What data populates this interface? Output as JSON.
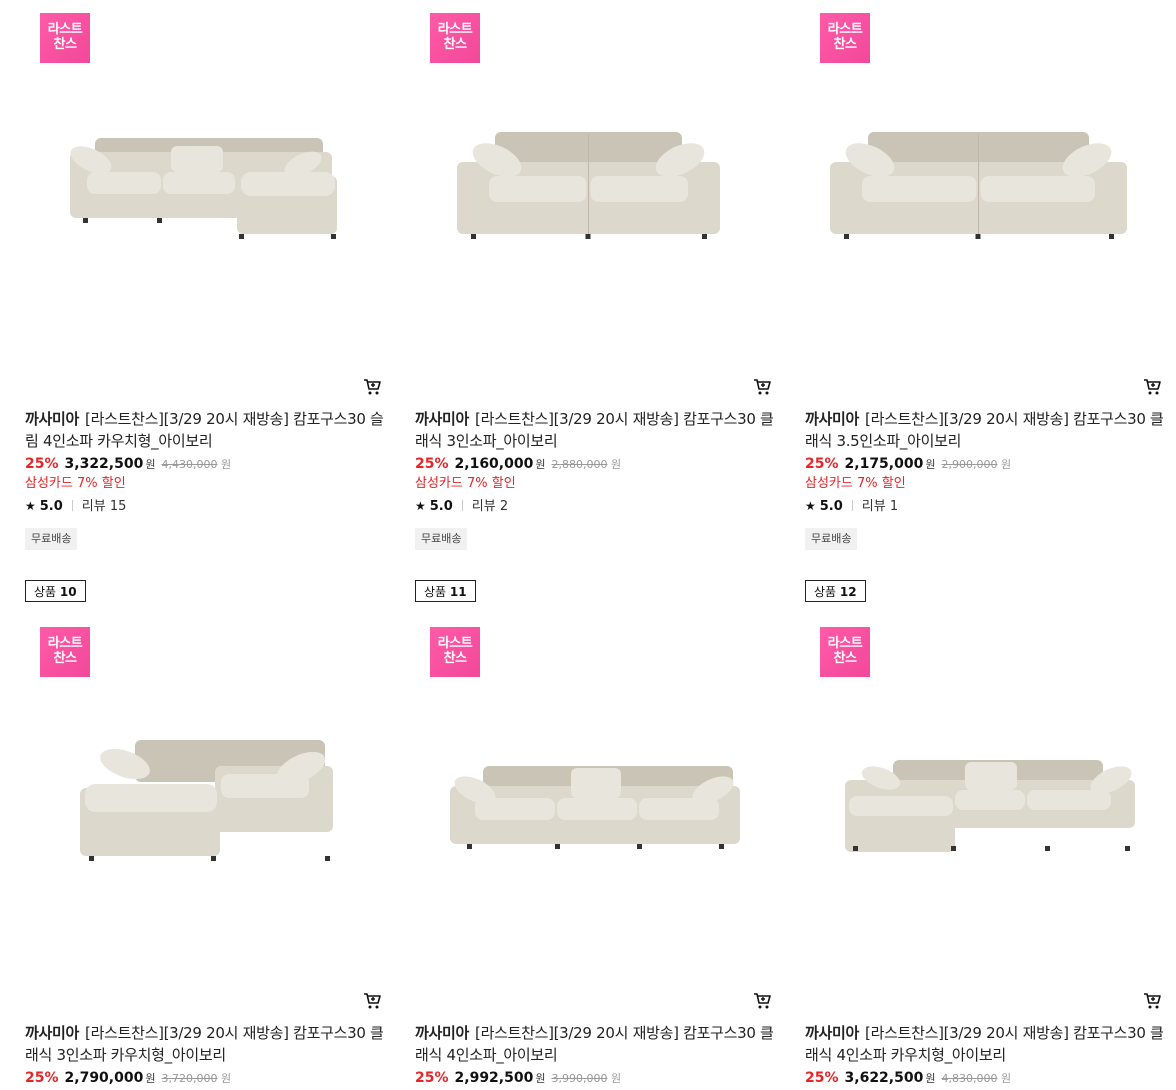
{
  "products": [
    {
      "counter_label": "",
      "counter_num": "",
      "badge_line1": "라스트",
      "badge_line2": "찬스",
      "brand": "까사미아",
      "title": "[라스트찬스][3/29 20시 재방송] 캄포구스30 슬림 4인소파 카우치형_아이보리",
      "discount_rate": "25%",
      "price": "3,322,500",
      "currency": "원",
      "original_price": "4,430,000",
      "card_discount": "삼성카드 7% 할인",
      "rating": "5.0",
      "review_label": "리뷰 15",
      "tag": "무료배송",
      "sofa_type": "4-seat-couch"
    },
    {
      "counter_label": "",
      "counter_num": "",
      "badge_line1": "라스트",
      "badge_line2": "찬스",
      "brand": "까사미아",
      "title": "[라스트찬스][3/29 20시 재방송] 캄포구스30 클래식 3인소파_아이보리",
      "discount_rate": "25%",
      "price": "2,160,000",
      "currency": "원",
      "original_price": "2,880,000",
      "card_discount": "삼성카드 7% 할인",
      "rating": "5.0",
      "review_label": "리뷰 2",
      "tag": "무료배송",
      "sofa_type": "3-seat"
    },
    {
      "counter_label": "",
      "counter_num": "",
      "badge_line1": "라스트",
      "badge_line2": "찬스",
      "brand": "까사미아",
      "title": "[라스트찬스][3/29 20시 재방송] 캄포구스30 클래식 3.5인소파_아이보리",
      "discount_rate": "25%",
      "price": "2,175,000",
      "currency": "원",
      "original_price": "2,900,000",
      "card_discount": "삼성카드 7% 할인",
      "rating": "5.0",
      "review_label": "리뷰 1",
      "tag": "무료배송",
      "sofa_type": "3.5-seat"
    },
    {
      "counter_label": "상품",
      "counter_num": "10",
      "badge_line1": "라스트",
      "badge_line2": "찬스",
      "brand": "까사미아",
      "title": "[라스트찬스][3/29 20시 재방송] 캄포구스30 클래식 3인소파 카우치형_아이보리",
      "discount_rate": "25%",
      "price": "2,790,000",
      "currency": "원",
      "original_price": "3,720,000",
      "sofa_type": "3-seat-couch"
    },
    {
      "counter_label": "상품",
      "counter_num": "11",
      "badge_line1": "라스트",
      "badge_line2": "찬스",
      "brand": "까사미아",
      "title": "[라스트찬스][3/29 20시 재방송] 캄포구스30 클래식 4인소파_아이보리",
      "discount_rate": "25%",
      "price": "2,992,500",
      "currency": "원",
      "original_price": "3,990,000",
      "sofa_type": "4-seat"
    },
    {
      "counter_label": "상품",
      "counter_num": "12",
      "badge_line1": "라스트",
      "badge_line2": "찬스",
      "brand": "까사미아",
      "title": "[라스트찬스][3/29 20시 재방송] 캄포구스30 클래식 4인소파 카우치형_아이보리",
      "discount_rate": "25%",
      "price": "3,622,500",
      "currency": "원",
      "original_price": "4,830,000",
      "sofa_type": "4-seat-couch"
    }
  ],
  "colors": {
    "badge": "#f2489b",
    "discount": "#e52528",
    "sofa": "#dcd8cc"
  },
  "icons": {
    "cart": "shopping-cart-icon",
    "star": "star-icon"
  }
}
